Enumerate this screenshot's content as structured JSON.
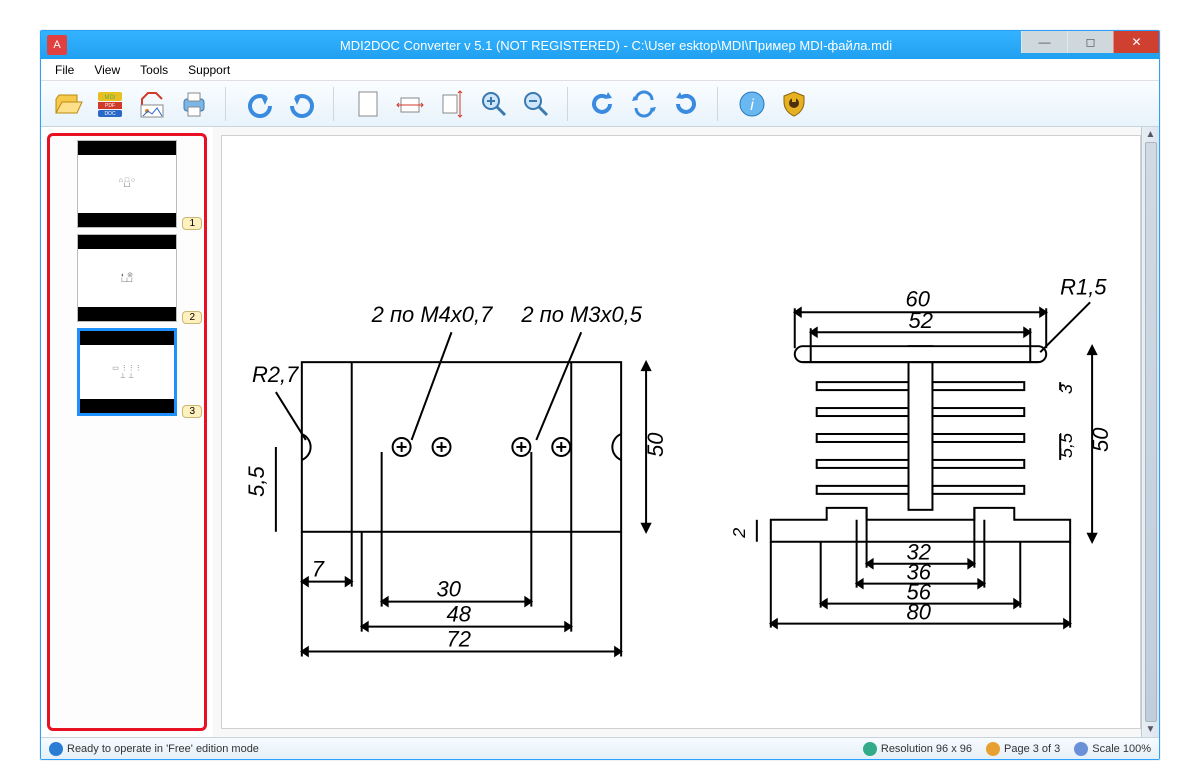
{
  "window": {
    "title": "MDI2DOC Converter v 5.1   (NOT REGISTERED)   -   C:\\User          esktop\\MDI\\Пример MDI-файла.mdi"
  },
  "menu": {
    "file": "File",
    "view": "View",
    "tools": "Tools",
    "support": "Support"
  },
  "thumbs": {
    "items": [
      {
        "page_label": "1"
      },
      {
        "page_label": "2"
      },
      {
        "page_label": "3"
      }
    ]
  },
  "drawing": {
    "labels": {
      "r27": "R2,7",
      "m4": "2 по М4х0,7",
      "m3": "2 по М3х0,5",
      "d50_left": "50",
      "d55": "5,5",
      "d7": "7",
      "d30": "30",
      "d48": "48",
      "d72": "72",
      "r15": "R1,5",
      "d60": "60",
      "d52": "52",
      "d3": "3",
      "d55r": "5,5",
      "d50_right": "50",
      "d2": "2",
      "d32": "32",
      "d36": "36",
      "d56": "56",
      "d80": "80"
    }
  },
  "status": {
    "ready": "Ready to operate in 'Free' edition mode",
    "resolution": "Resolution 96 x 96",
    "page": "Page 3 of 3",
    "scale": "Scale 100%"
  }
}
